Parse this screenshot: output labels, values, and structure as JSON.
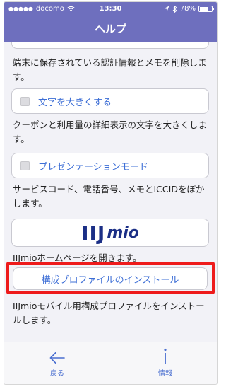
{
  "status_bar": {
    "signal_dots": "●●●●●",
    "carrier": "docomo",
    "time": "13:30",
    "battery_text": "78%",
    "battery_level": 0.78,
    "icons": [
      "wifi-icon",
      "location-arrow-icon",
      "bluetooth-icon",
      "battery-icon"
    ]
  },
  "nav": {
    "title": "ヘルプ"
  },
  "content": {
    "desc_0": "端末に保存されている認証情報とメモを削除します。",
    "toggle_large_text": {
      "label": "文字を大きくする",
      "checked": false
    },
    "desc_1": "クーポンと利用量の詳細表示の文字を大きくします。",
    "toggle_presentation": {
      "label": "プレゼンテーションモード",
      "checked": false
    },
    "desc_2": "サービスコード、電話番号、メモとICCIDをぼかします。",
    "logo": {
      "ij": "IIJ",
      "mio": "mio"
    },
    "desc_3": "IIJmioホームページを開きます。",
    "install_button": "構成プロファイルのインストール",
    "desc_4": "IIJmioモバイル用構成プロファイルをインストールします。"
  },
  "tabbar": {
    "back_label": "戻る",
    "info_label": "情報"
  },
  "colors": {
    "nav_bg": "#6e6fbe",
    "link_blue": "#3e6fd6",
    "highlight_red": "#ee1b1b",
    "logo_navy": "#1b2f86"
  }
}
